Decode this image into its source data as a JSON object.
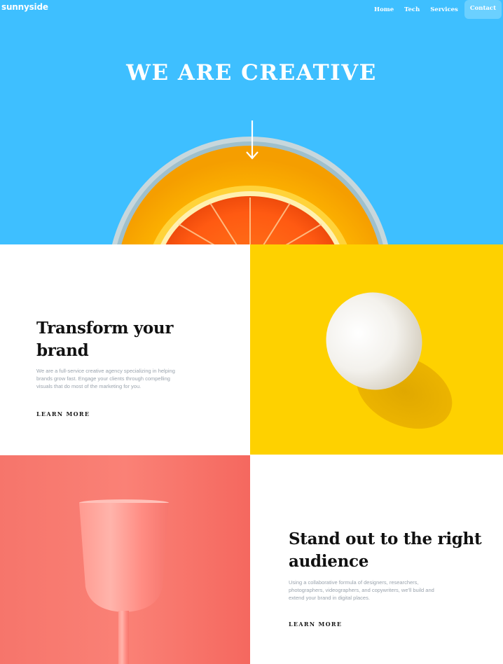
{
  "brand": {
    "logo": "sunnyside"
  },
  "nav": {
    "items": [
      {
        "label": "Home"
      },
      {
        "label": "Tech"
      },
      {
        "label": "Services"
      }
    ],
    "cta": "Contact"
  },
  "hero": {
    "title": "WE ARE CREATIVE",
    "arrow_icon": "arrow-down-icon"
  },
  "sections": [
    {
      "heading": "Transform your brand",
      "body": "We are a full-service creative agency specializing in helping brands grow fast. Engage your clients through compelling visuals that do most of the marketing for you.",
      "link": "LEARN MORE",
      "underline_color": "#fad400",
      "image_bg": "#fed100"
    },
    {
      "heading": "Stand out to the right audience",
      "body": "Using a collaborative formula of designers, researchers, photographers, videographers, and copywriters, we'll build and extend your brand in digital places.",
      "link": "LEARN MORE",
      "underline_color": "#fdf27a",
      "image_bg": "#f96b62"
    }
  ],
  "colors": {
    "hero_bg": "#3ebfff",
    "contact_bg": "#6bd0ff",
    "heading": "#111111",
    "body_text": "#9aa3ad"
  }
}
